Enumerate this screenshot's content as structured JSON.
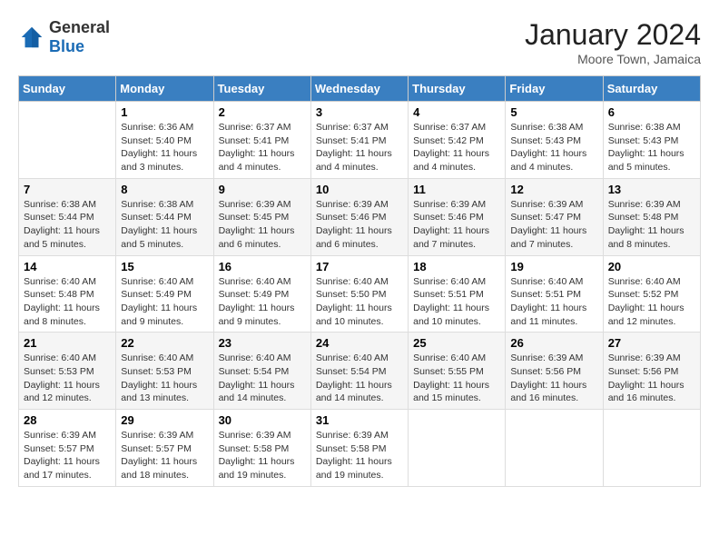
{
  "header": {
    "logo_general": "General",
    "logo_blue": "Blue",
    "month_year": "January 2024",
    "location": "Moore Town, Jamaica"
  },
  "days_of_week": [
    "Sunday",
    "Monday",
    "Tuesday",
    "Wednesday",
    "Thursday",
    "Friday",
    "Saturday"
  ],
  "weeks": [
    [
      {
        "day": "",
        "detail": ""
      },
      {
        "day": "1",
        "detail": "Sunrise: 6:36 AM\nSunset: 5:40 PM\nDaylight: 11 hours\nand 3 minutes."
      },
      {
        "day": "2",
        "detail": "Sunrise: 6:37 AM\nSunset: 5:41 PM\nDaylight: 11 hours\nand 4 minutes."
      },
      {
        "day": "3",
        "detail": "Sunrise: 6:37 AM\nSunset: 5:41 PM\nDaylight: 11 hours\nand 4 minutes."
      },
      {
        "day": "4",
        "detail": "Sunrise: 6:37 AM\nSunset: 5:42 PM\nDaylight: 11 hours\nand 4 minutes."
      },
      {
        "day": "5",
        "detail": "Sunrise: 6:38 AM\nSunset: 5:43 PM\nDaylight: 11 hours\nand 4 minutes."
      },
      {
        "day": "6",
        "detail": "Sunrise: 6:38 AM\nSunset: 5:43 PM\nDaylight: 11 hours\nand 5 minutes."
      }
    ],
    [
      {
        "day": "7",
        "detail": "Sunrise: 6:38 AM\nSunset: 5:44 PM\nDaylight: 11 hours\nand 5 minutes."
      },
      {
        "day": "8",
        "detail": "Sunrise: 6:38 AM\nSunset: 5:44 PM\nDaylight: 11 hours\nand 5 minutes."
      },
      {
        "day": "9",
        "detail": "Sunrise: 6:39 AM\nSunset: 5:45 PM\nDaylight: 11 hours\nand 6 minutes."
      },
      {
        "day": "10",
        "detail": "Sunrise: 6:39 AM\nSunset: 5:46 PM\nDaylight: 11 hours\nand 6 minutes."
      },
      {
        "day": "11",
        "detail": "Sunrise: 6:39 AM\nSunset: 5:46 PM\nDaylight: 11 hours\nand 7 minutes."
      },
      {
        "day": "12",
        "detail": "Sunrise: 6:39 AM\nSunset: 5:47 PM\nDaylight: 11 hours\nand 7 minutes."
      },
      {
        "day": "13",
        "detail": "Sunrise: 6:39 AM\nSunset: 5:48 PM\nDaylight: 11 hours\nand 8 minutes."
      }
    ],
    [
      {
        "day": "14",
        "detail": "Sunrise: 6:40 AM\nSunset: 5:48 PM\nDaylight: 11 hours\nand 8 minutes."
      },
      {
        "day": "15",
        "detail": "Sunrise: 6:40 AM\nSunset: 5:49 PM\nDaylight: 11 hours\nand 9 minutes."
      },
      {
        "day": "16",
        "detail": "Sunrise: 6:40 AM\nSunset: 5:49 PM\nDaylight: 11 hours\nand 9 minutes."
      },
      {
        "day": "17",
        "detail": "Sunrise: 6:40 AM\nSunset: 5:50 PM\nDaylight: 11 hours\nand 10 minutes."
      },
      {
        "day": "18",
        "detail": "Sunrise: 6:40 AM\nSunset: 5:51 PM\nDaylight: 11 hours\nand 10 minutes."
      },
      {
        "day": "19",
        "detail": "Sunrise: 6:40 AM\nSunset: 5:51 PM\nDaylight: 11 hours\nand 11 minutes."
      },
      {
        "day": "20",
        "detail": "Sunrise: 6:40 AM\nSunset: 5:52 PM\nDaylight: 11 hours\nand 12 minutes."
      }
    ],
    [
      {
        "day": "21",
        "detail": "Sunrise: 6:40 AM\nSunset: 5:53 PM\nDaylight: 11 hours\nand 12 minutes."
      },
      {
        "day": "22",
        "detail": "Sunrise: 6:40 AM\nSunset: 5:53 PM\nDaylight: 11 hours\nand 13 minutes."
      },
      {
        "day": "23",
        "detail": "Sunrise: 6:40 AM\nSunset: 5:54 PM\nDaylight: 11 hours\nand 14 minutes."
      },
      {
        "day": "24",
        "detail": "Sunrise: 6:40 AM\nSunset: 5:54 PM\nDaylight: 11 hours\nand 14 minutes."
      },
      {
        "day": "25",
        "detail": "Sunrise: 6:40 AM\nSunset: 5:55 PM\nDaylight: 11 hours\nand 15 minutes."
      },
      {
        "day": "26",
        "detail": "Sunrise: 6:39 AM\nSunset: 5:56 PM\nDaylight: 11 hours\nand 16 minutes."
      },
      {
        "day": "27",
        "detail": "Sunrise: 6:39 AM\nSunset: 5:56 PM\nDaylight: 11 hours\nand 16 minutes."
      }
    ],
    [
      {
        "day": "28",
        "detail": "Sunrise: 6:39 AM\nSunset: 5:57 PM\nDaylight: 11 hours\nand 17 minutes."
      },
      {
        "day": "29",
        "detail": "Sunrise: 6:39 AM\nSunset: 5:57 PM\nDaylight: 11 hours\nand 18 minutes."
      },
      {
        "day": "30",
        "detail": "Sunrise: 6:39 AM\nSunset: 5:58 PM\nDaylight: 11 hours\nand 19 minutes."
      },
      {
        "day": "31",
        "detail": "Sunrise: 6:39 AM\nSunset: 5:58 PM\nDaylight: 11 hours\nand 19 minutes."
      },
      {
        "day": "",
        "detail": ""
      },
      {
        "day": "",
        "detail": ""
      },
      {
        "day": "",
        "detail": ""
      }
    ]
  ]
}
